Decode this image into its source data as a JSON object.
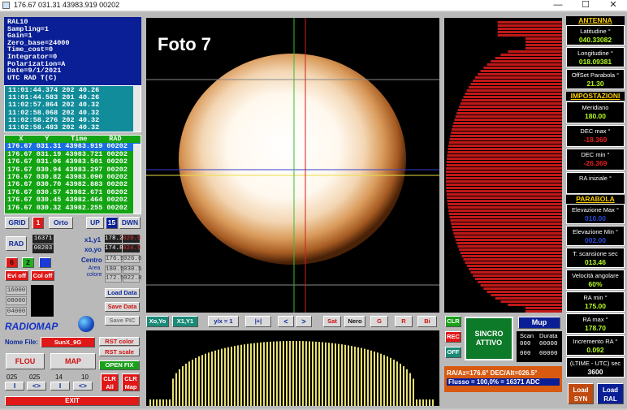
{
  "window": {
    "title": "176.67 031.31  43983.919 00202",
    "min": "—",
    "max": "☐",
    "close": "✕"
  },
  "info_panel": [
    "RAL10",
    "Sampling=1",
    "Gain=1",
    "Zero_base=24000",
    "Time_cost=0",
    "Integrator=0",
    "Polarization=A",
    "Date=9/1/2021",
    "UTC RAD T(C)"
  ],
  "log_lines": [
    "11:01:44.374 202 40.26",
    "11:01:44.583 201 40.26",
    "11:02:57.864 202 40.32",
    "11:02:58.068 202 40.32",
    "11:02:58.276 202 40.32",
    "11:02:58.483 202 40.32"
  ],
  "table": {
    "headers": [
      "X",
      "Y",
      "Time",
      "RAD"
    ],
    "rows": [
      "176.67 031.31  43983.919 00202",
      "176.67 031.19  43983.721 00202",
      "176.67 031.06  43983.501 00202",
      "176.67 030.94  43983.297 00202",
      "176.67 030.82  43983.090 00202",
      "176.67 030.70  43982.883 00202",
      "176.67 030.57  43982.671 00202",
      "176.67 030.45  43982.464 00202",
      "176.67 030.32  43982.255 00202"
    ]
  },
  "controls": {
    "grid": "GRID",
    "grid_val": "1",
    "orto": "Orto",
    "up": "UP",
    "up_val": "15",
    "dwn": "DWN",
    "rad": "RAD",
    "rad_v1": "16371",
    "rad_v2": "00203",
    "x1y1": "x1,y1",
    "x1y1_a": "178.2",
    "x1y1_b": "029.9",
    "xoyo": "xo,yo",
    "xoyo_a": "174.8",
    "xoyo_b": "024.9",
    "centro": "Centro",
    "centro_a": "176.5",
    "centro_b": "026.6",
    "area_colore": "Area\ncolore",
    "area_a": "180.5",
    "area_b": "030.5",
    "area_c": "172.5",
    "area_d": "022.8",
    "n6": "6",
    "n2": "2",
    "evi_off": "Evi off",
    "col_off": "Col off",
    "levels": [
      "16000",
      "08000",
      "04000"
    ],
    "load_data": "Load Data",
    "save_data": "Save Data",
    "save_pic": "Save PIC",
    "radiomap": "RADIOMAP",
    "nome_file": "Nome File:",
    "file_value": "SunX_9G",
    "rst_color": "RST color",
    "rst_scale": "RST scale",
    "open_fix": "OPEN FIX",
    "flou": "FLOU",
    "map": "MAP",
    "nums": [
      "025",
      "025",
      "14",
      "10"
    ],
    "i": "I",
    "lr": "<>",
    "clr_all": "CLR\nAll",
    "clr_map": "CLR\nMap",
    "exit": "EXIT"
  },
  "image_label": "Foto 7",
  "toolbar": [
    "Xo,Yo",
    "X1,Y1",
    "y/x = 1",
    "|+|",
    "<",
    ">",
    "Sat",
    "Nero",
    "G",
    "R",
    "Bi"
  ],
  "right_controls": {
    "clr": "CLR",
    "rec": "REC",
    "off": "OFF",
    "sincro": "SINCRO\nATTIVO",
    "mup": "Mup",
    "scan": "Scan",
    "durata": "Durata",
    "scan_a": "000",
    "durata_a": "00000",
    "scan_b": "000",
    "durata_b": "00000",
    "status1": "RA/Az=176.6°  DEC/Alt=026.5°",
    "status2": "Flusso = 100,0% = 16371 ADC"
  },
  "antenna": {
    "title": "ANTENNA",
    "latitudine_label": "Latitudine °",
    "latitudine": "040.33082",
    "longitudine_label": "Longitudine °",
    "longitudine": "018.09381",
    "offset_label": "OffSet Parabola °",
    "offset": "21.30"
  },
  "impostazioni": {
    "title": "IMPOSTAZIONI",
    "meridiano_label": "Meridiano",
    "meridiano": "180.00",
    "decmax_label": "DEC max °",
    "decmax": "-18.369",
    "decmin_label": "DEC min °",
    "decmin": "-26.369",
    "rainiziale_label": "RA iniziale °",
    "rainiziale": ""
  },
  "parabola": {
    "title": "PARABOLA",
    "elevmax_label": "Elevazione Max °",
    "elevmax": "010.00",
    "elevmin_label": "Elevazione Min °",
    "elevmin": "002.00",
    "tscan_label": "T. scansione sec",
    "tscan": "013.46",
    "vel_label": "Velocità angolare",
    "vel": "60%",
    "ramin_label": "RA min °",
    "ramin": "175.00",
    "ramax_label": "RA max °",
    "ramax": "178.70",
    "incr_label": "Incremento RA °",
    "incr": "0.092",
    "ltime_label": "(LTIME - UTC) sec",
    "ltime": "3600"
  },
  "bottom_right": {
    "load_syn": "Load\nSYN",
    "load_ral": "Load\nRAL"
  },
  "colors": {
    "panel_blue": "#0a1f96",
    "teal": "#118c9a",
    "green": "#13a413",
    "hist_red": "#c01818",
    "value_green": "#b8ff20"
  }
}
